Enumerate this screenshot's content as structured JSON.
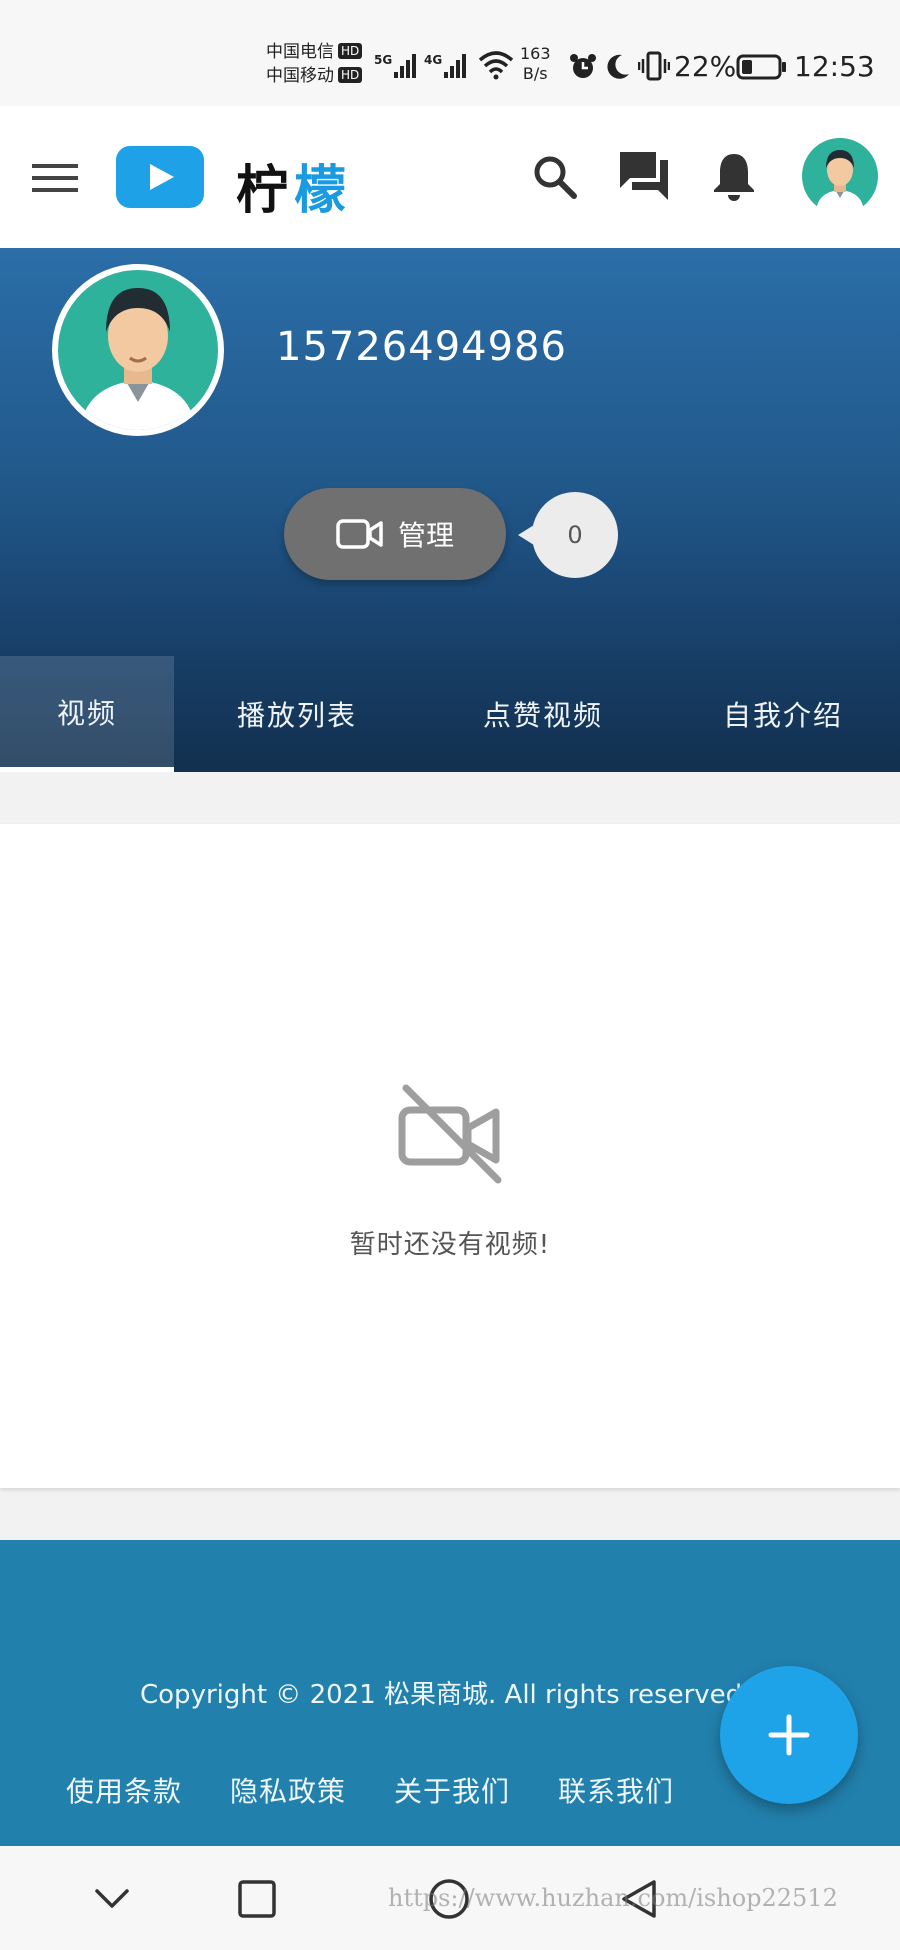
{
  "status_bar": {
    "carrier_1": "中国电信",
    "carrier_2": "中国移动",
    "hd_badge": "HD",
    "signal_1": "5G",
    "signal_2": "4G",
    "net_speed_value": "163",
    "net_speed_unit": "B/s",
    "battery_percent": "22%",
    "time": "12:53"
  },
  "header": {
    "logo_char_1": "柠",
    "logo_char_2": "檬",
    "colors": {
      "brand_blue": "#1a9ae0",
      "logo_bg": "#1ea1e6"
    }
  },
  "profile": {
    "phone": "15726494986",
    "manage_label": "管理",
    "video_count": "0",
    "tabs": [
      {
        "label": "视频",
        "active": true
      },
      {
        "label": "播放列表",
        "active": false
      },
      {
        "label": "点赞视频",
        "active": false
      },
      {
        "label": "自我介绍",
        "active": false
      }
    ]
  },
  "content": {
    "empty_message": "暂时还没有视频!"
  },
  "footer": {
    "copyright": "Copyright © 2021 松果商城. All rights reserved.",
    "links": [
      "使用条款",
      "隐私政策",
      "关于我们",
      "联系我们"
    ],
    "colors": {
      "footer_bg": "#2280ad",
      "fab_bg": "#1ea3e8"
    }
  },
  "watermark": "https://www.huzhan.com/ishop22512"
}
